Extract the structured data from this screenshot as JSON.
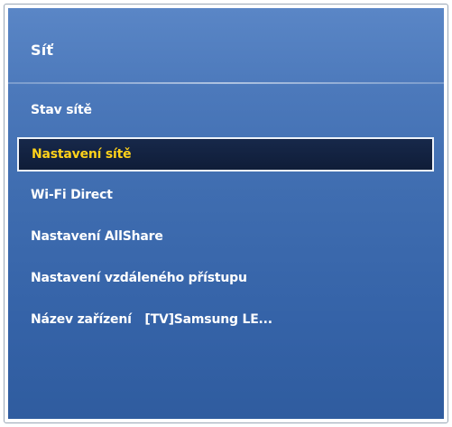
{
  "menu": {
    "title": "Síť",
    "items": [
      {
        "label": "Stav sítě"
      },
      {
        "label": "Nastavení sítě",
        "selected": true
      },
      {
        "label": "Wi-Fi Direct"
      },
      {
        "label": "Nastavení AllShare"
      },
      {
        "label": "Nastavení vzdáleného přístupu"
      },
      {
        "label": "Název zařízení",
        "value": "[TV]Samsung LE..."
      }
    ]
  },
  "colors": {
    "panel_background": "#3f6db0",
    "selected_background": "#13233f",
    "selected_text": "#ffd21a",
    "text": "#ffffff"
  }
}
